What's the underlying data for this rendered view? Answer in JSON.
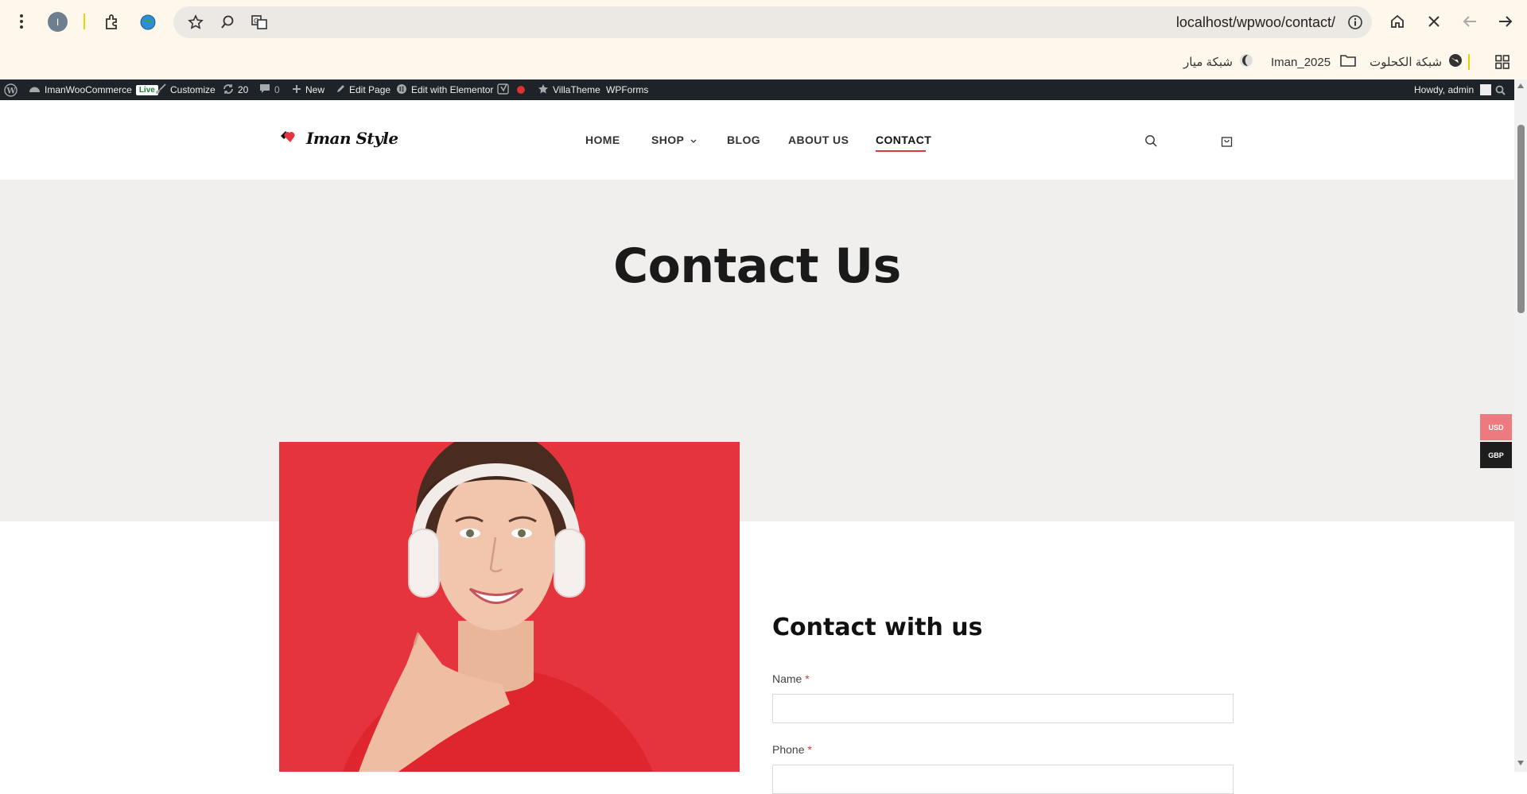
{
  "browser": {
    "url": "localhost/wpwoo/contact/",
    "profile_initial": "I",
    "bookmarks": [
      {
        "label": "شبكة الكحلوت",
        "icon": "globe-icon"
      },
      {
        "label": "Iman_2025",
        "icon": "folder-icon"
      },
      {
        "label": "شبكة ميار",
        "icon": "moon-icon"
      }
    ]
  },
  "adminbar": {
    "site_name": "ImanWooCommerce",
    "live_badge": "Live",
    "customize": "Customize",
    "updates_count": "20",
    "comments_count": "0",
    "new": "New",
    "edit_page": "Edit Page",
    "edit_elementor": "Edit with Elementor",
    "villatheme": "VillaTheme",
    "wpforms": "WPForms",
    "howdy": "Howdy, admin"
  },
  "header": {
    "logo_text": "Iman Style",
    "nav": [
      "HOME",
      "SHOP",
      "BLOG",
      "ABOUT US",
      "CONTACT"
    ],
    "active_nav": "CONTACT"
  },
  "hero": {
    "title": "Contact Us"
  },
  "form": {
    "heading": "Contact with us",
    "fields": [
      {
        "label": "Name",
        "required_mark": "*"
      },
      {
        "label": "Phone",
        "required_mark": "*"
      }
    ]
  },
  "currency": {
    "options": [
      "USD",
      "GBP"
    ],
    "colors": {
      "usd": "#ec7a7e",
      "gbp": "#1d1d1d"
    }
  },
  "colors": {
    "accent": "#e5343e",
    "hero_bg": "#f0efed",
    "adminbar_bg": "#1d2327",
    "chrome_bg": "#fef8ec"
  }
}
